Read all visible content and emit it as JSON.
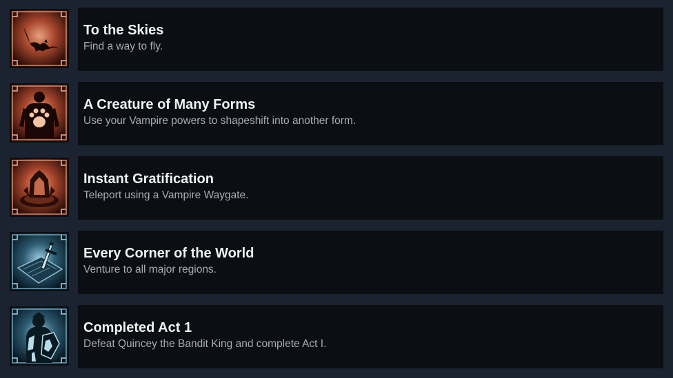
{
  "achievements": [
    {
      "title": "To the Skies",
      "description": "Find a way to fly.",
      "icon": "bat-icon",
      "theme": "red"
    },
    {
      "title": "A Creature of Many Forms",
      "description": "Use your Vampire powers to shapeshift into another form.",
      "icon": "shapeshift-paw-icon",
      "theme": "red"
    },
    {
      "title": "Instant Gratification",
      "description": "Teleport using a Vampire Waygate.",
      "icon": "waygate-icon",
      "theme": "red"
    },
    {
      "title": "Every Corner of the World",
      "description": "Venture to all major regions.",
      "icon": "map-sword-icon",
      "theme": "blue"
    },
    {
      "title": "Completed Act 1",
      "description": "Defeat Quincey the Bandit King and complete Act I.",
      "icon": "bandit-king-icon",
      "theme": "blue"
    }
  ],
  "colors": {
    "background": "#1b2330",
    "panel": "#0b0e13",
    "title": "#f0f0f0",
    "description": "#a9adb3",
    "red_accent": "#c96a4e",
    "blue_accent": "#7fb3c9"
  }
}
